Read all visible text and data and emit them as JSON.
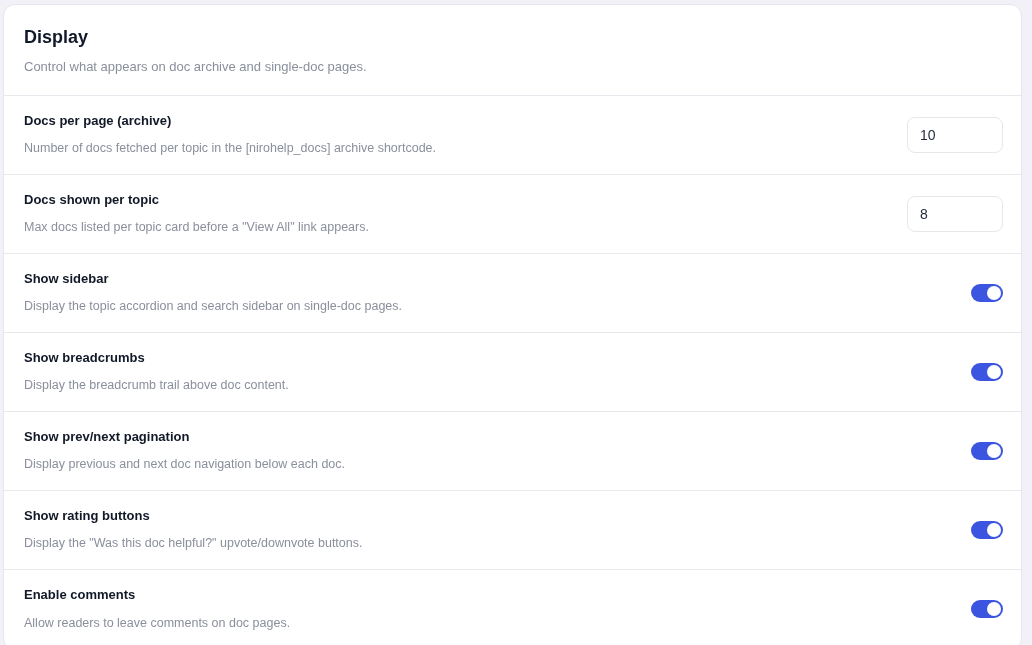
{
  "section": {
    "title": "Display",
    "description": "Control what appears on doc archive and single-doc pages."
  },
  "settings": [
    {
      "kind": "number",
      "label": "Docs per page (archive)",
      "description": "Number of docs fetched per topic in the [nirohelp_docs] archive shortcode.",
      "value": "10"
    },
    {
      "kind": "number",
      "label": "Docs shown per topic",
      "description": "Max docs listed per topic card before a \"View All\" link appears.",
      "value": "8"
    },
    {
      "kind": "toggle",
      "label": "Show sidebar",
      "description": "Display the topic accordion and search sidebar on single-doc pages.",
      "on": true
    },
    {
      "kind": "toggle",
      "label": "Show breadcrumbs",
      "description": "Display the breadcrumb trail above doc content.",
      "on": true
    },
    {
      "kind": "toggle",
      "label": "Show prev/next pagination",
      "description": "Display previous and next doc navigation below each doc.",
      "on": true
    },
    {
      "kind": "toggle",
      "label": "Show rating buttons",
      "description": "Display the \"Was this doc helpful?\" upvote/downvote buttons.",
      "on": true
    },
    {
      "kind": "toggle",
      "label": "Enable comments",
      "description": "Allow readers to leave comments on doc pages.",
      "on": true
    }
  ]
}
